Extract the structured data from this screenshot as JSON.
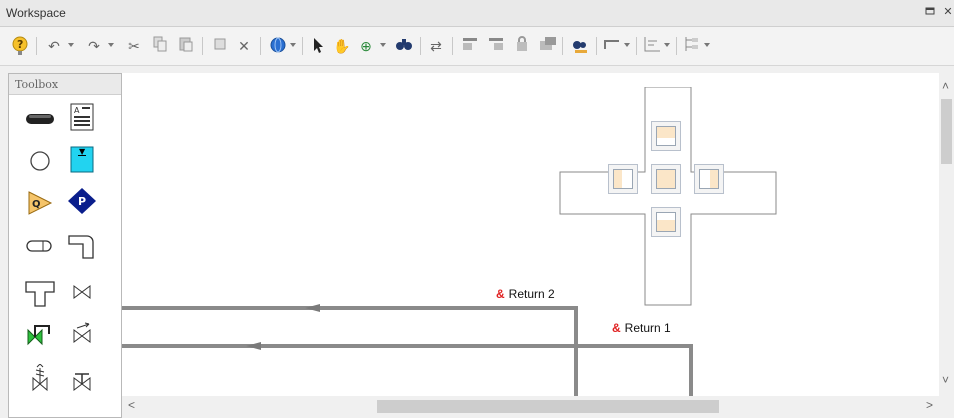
{
  "window": {
    "title": "Workspace",
    "restore_icon": "restore-icon",
    "close_icon": "close-icon"
  },
  "toolbar": {
    "items": [
      "help-icon",
      "undo-icon",
      "redo-icon",
      "cut-icon",
      "copy-icon",
      "paste-icon",
      "select-box-icon",
      "delete-icon",
      "globe-icon",
      "pointer-icon",
      "pan-hand-icon",
      "zoom-icon",
      "find-icon",
      "reverse-icon",
      "align-left-icon",
      "align-right-icon",
      "lock-icon",
      "group-icon",
      "find-replace-icon",
      "pipe-style-icon",
      "grid-icon",
      "layout-icon"
    ]
  },
  "toolbox": {
    "title": "Toolbox",
    "tools": [
      "pipe-tool",
      "annotation-tool",
      "junction-tool",
      "reservoir-tool",
      "flow-source-tool",
      "pump-tool",
      "bend-tool",
      "elbow-tool",
      "tee-tool",
      "valve-tool",
      "control-valve-tool",
      "check-valve-tool",
      "relief-valve-tool",
      "general-valve-tool"
    ]
  },
  "workspace": {
    "pipes": [
      {
        "label_prefix": "&",
        "label": "Return 2"
      },
      {
        "label_prefix": "&",
        "label": "Return 1"
      }
    ]
  },
  "colors": {
    "pipe": "#8a8a8a",
    "label_accent": "#e02020",
    "reservoir": "#22d3f0",
    "pump": "#0a1e8c",
    "flow_source": "#f5c46a"
  }
}
